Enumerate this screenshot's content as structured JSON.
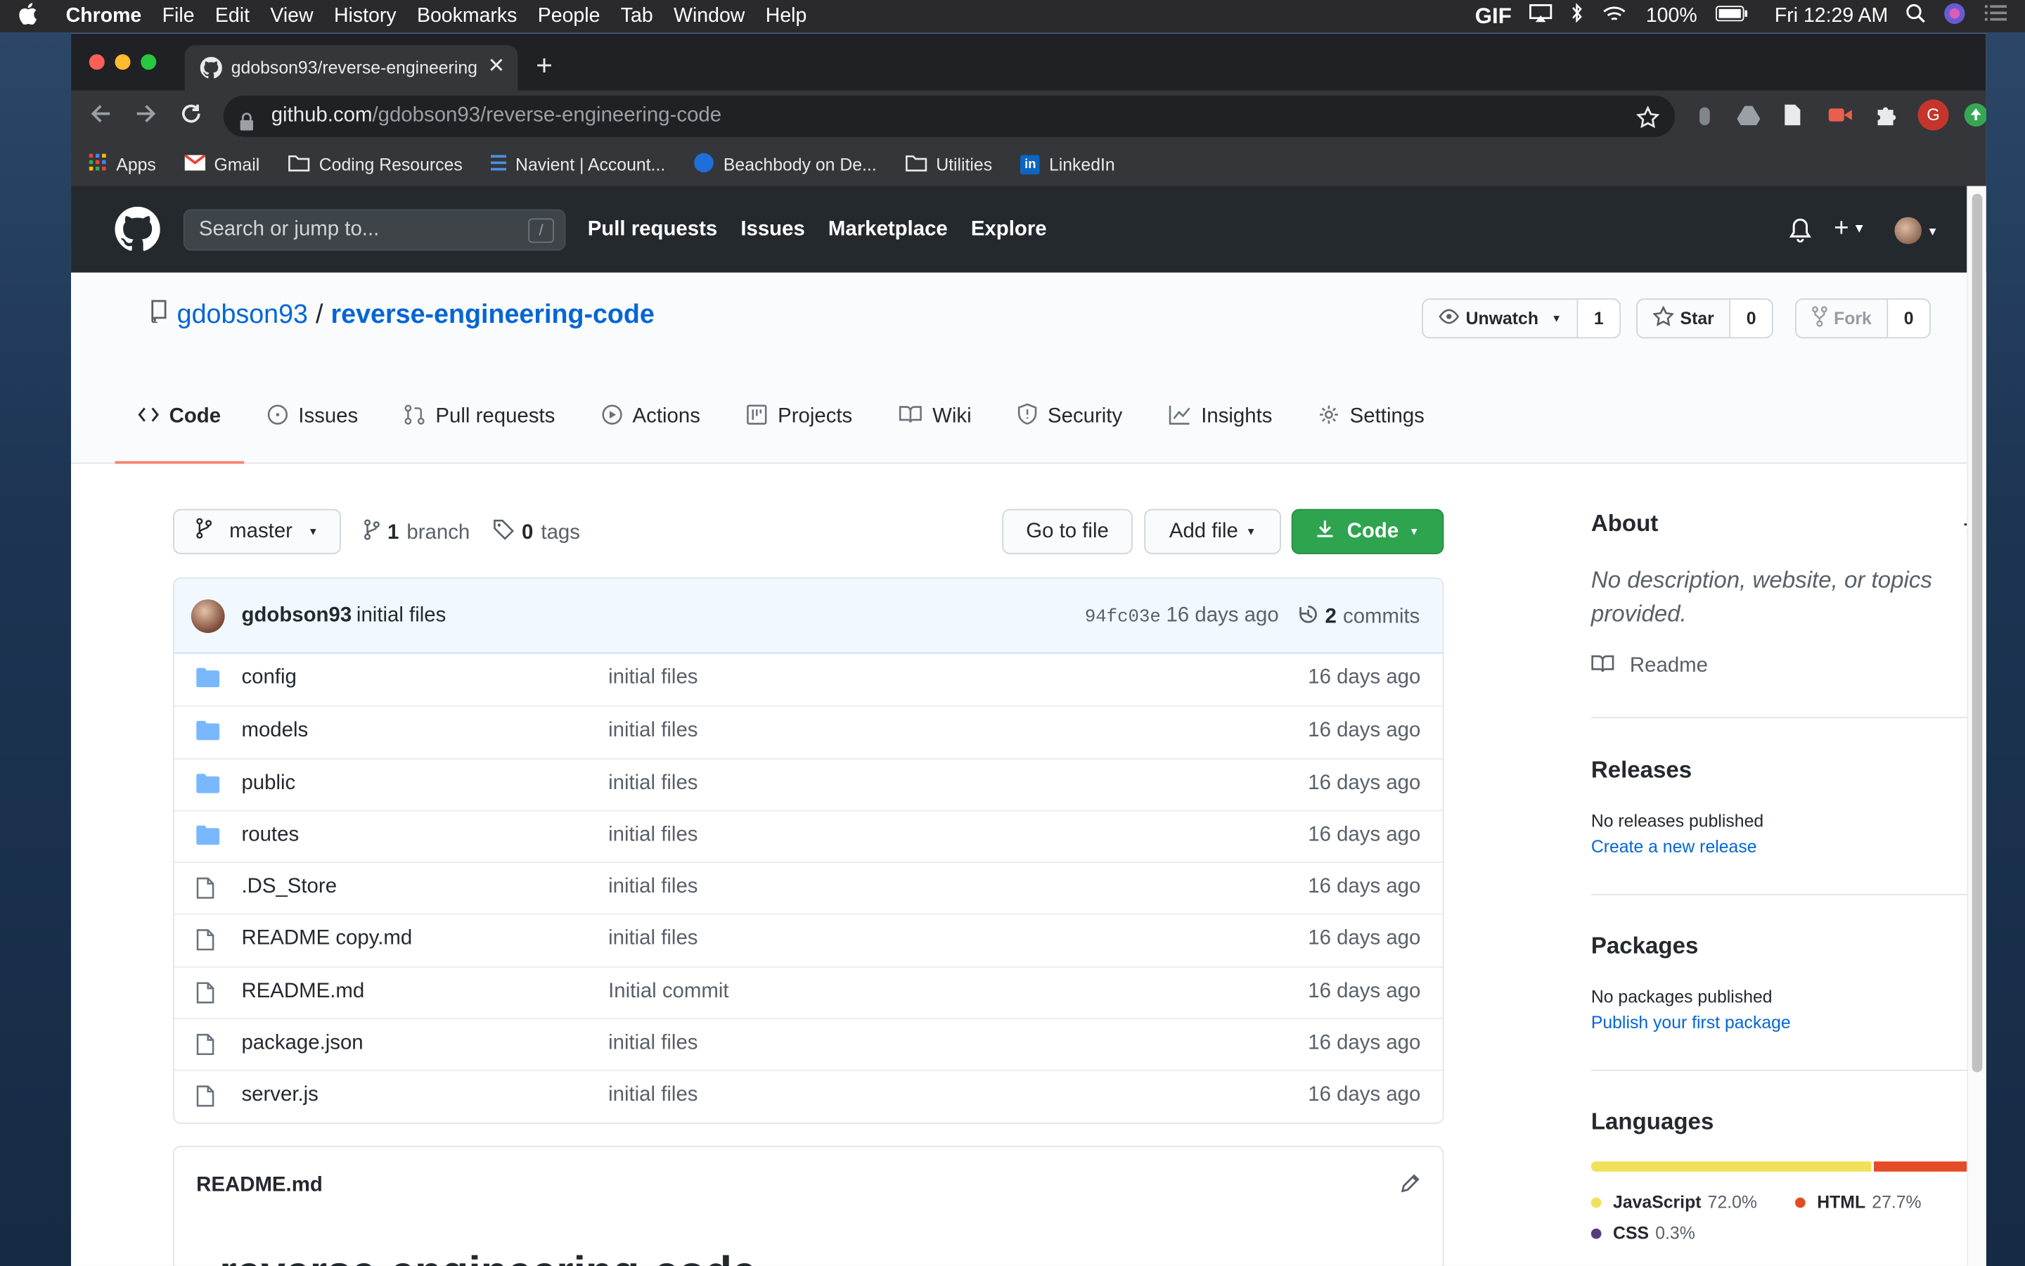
{
  "os_menubar": {
    "app": "Chrome",
    "menus": [
      "File",
      "Edit",
      "View",
      "History",
      "Bookmarks",
      "People",
      "Tab",
      "Window",
      "Help"
    ],
    "gif": "GIF",
    "battery": "100%",
    "clock": "Fri 12:29 AM"
  },
  "browser": {
    "tab_title": "gdobson93/reverse-engineering-code",
    "url_host": "github.com",
    "url_path": "/gdobson93/reverse-engineering-code",
    "profile_initial": "G",
    "bookmarks": [
      "Apps",
      "Gmail",
      "Coding Resources",
      "Navient | Account...",
      "Beachbody on De...",
      "Utilities",
      "LinkedIn"
    ]
  },
  "github_header": {
    "search_placeholder": "Search or jump to...",
    "search_hint": "/",
    "nav": [
      "Pull requests",
      "Issues",
      "Marketplace",
      "Explore"
    ]
  },
  "repo": {
    "owner": "gdobson93",
    "separator": "/",
    "name": "reverse-engineering-code",
    "watch_label": "Unwatch",
    "watch_count": "1",
    "star_label": "Star",
    "star_count": "0",
    "fork_label": "Fork",
    "fork_count": "0",
    "tabs": [
      "Code",
      "Issues",
      "Pull requests",
      "Actions",
      "Projects",
      "Wiki",
      "Security",
      "Insights",
      "Settings"
    ]
  },
  "toolbar": {
    "branch": "master",
    "branch_count": "1",
    "branch_label": "branch",
    "tag_count": "0",
    "tag_label": "tags",
    "go_to_file": "Go to file",
    "add_file": "Add file",
    "code": "Code"
  },
  "commit": {
    "author": "gdobson93",
    "message": "initial files",
    "sha": "94fc03e",
    "age": "16 days ago",
    "count": "2",
    "count_label": "commits"
  },
  "files": [
    {
      "name": "config",
      "type": "dir",
      "message": "initial files",
      "age": "16 days ago"
    },
    {
      "name": "models",
      "type": "dir",
      "message": "initial files",
      "age": "16 days ago"
    },
    {
      "name": "public",
      "type": "dir",
      "message": "initial files",
      "age": "16 days ago"
    },
    {
      "name": "routes",
      "type": "dir",
      "message": "initial files",
      "age": "16 days ago"
    },
    {
      "name": ".DS_Store",
      "type": "file",
      "message": "initial files",
      "age": "16 days ago"
    },
    {
      "name": "README copy.md",
      "type": "file",
      "message": "initial files",
      "age": "16 days ago"
    },
    {
      "name": "README.md",
      "type": "file",
      "message": "Initial commit",
      "age": "16 days ago"
    },
    {
      "name": "package.json",
      "type": "file",
      "message": "initial files",
      "age": "16 days ago"
    },
    {
      "name": "server.js",
      "type": "file",
      "message": "initial files",
      "age": "16 days ago"
    }
  ],
  "readme": {
    "filename": "README.md",
    "heading": "reverse-engineering-code"
  },
  "sidebar": {
    "about_title": "About",
    "about_desc": "No description, website, or topics provided.",
    "readme_link": "Readme",
    "releases_title": "Releases",
    "releases_text": "No releases published",
    "releases_link": "Create a new release",
    "packages_title": "Packages",
    "packages_text": "No packages published",
    "packages_link": "Publish your first package",
    "languages_title": "Languages",
    "languages": [
      {
        "name": "JavaScript",
        "percent": "72.0%",
        "value": 72.0,
        "color": "#f1e05a"
      },
      {
        "name": "HTML",
        "percent": "27.7%",
        "value": 27.7,
        "color": "#e34c26"
      },
      {
        "name": "CSS",
        "percent": "0.3%",
        "value": 0.3,
        "color": "#563d7c"
      }
    ]
  }
}
